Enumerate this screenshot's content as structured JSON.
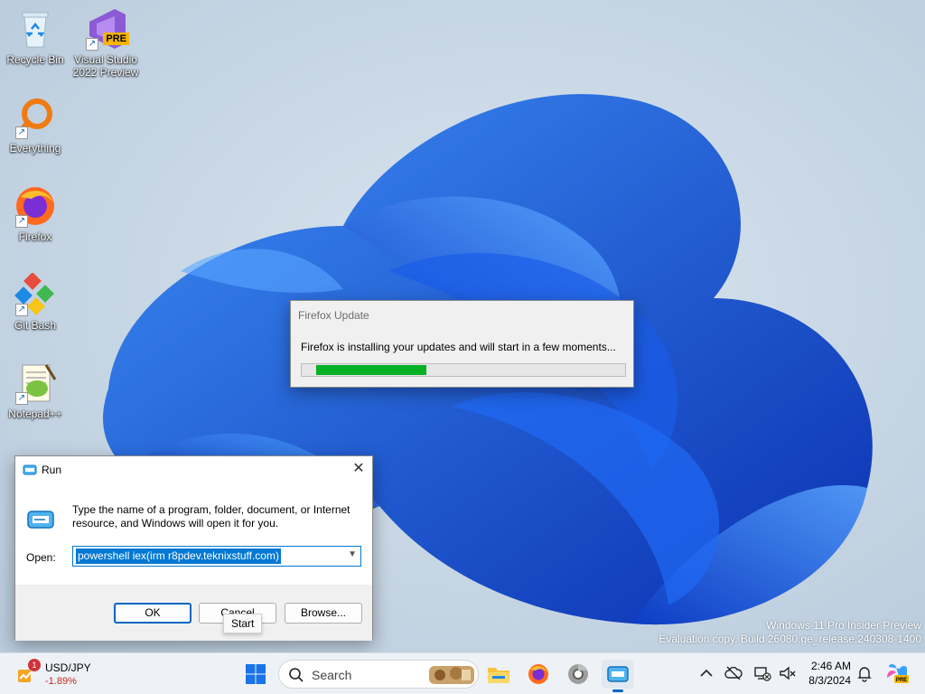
{
  "desktop": {
    "icons": [
      {
        "label": "Recycle Bin",
        "icon": "recycle-bin-icon"
      },
      {
        "label": "Visual Studio 2022 Preview",
        "icon": "visual-studio-icon",
        "badge": "PRE"
      },
      {
        "label": "Everything",
        "icon": "everything-search-icon"
      },
      {
        "label": "Firefox",
        "icon": "firefox-icon"
      },
      {
        "label": "Git Bash",
        "icon": "git-bash-icon"
      },
      {
        "label": "Notepad++",
        "icon": "notepad-plus-plus-icon"
      }
    ],
    "watermark": {
      "line1": "Windows 11 Pro Insider Preview",
      "line2": "Evaluation copy. Build 26080.ge_release.240308-1400"
    }
  },
  "firefox_update": {
    "title": "Firefox Update",
    "message": "Firefox is installing your updates and will start in a few moments...",
    "progress": 0.36,
    "progress_color": "#06b025"
  },
  "run_dialog": {
    "title": "Run",
    "description": "Type the name of a program, folder, document, or Internet resource, and Windows will open it for you.",
    "open_label": "Open:",
    "open_value": "powershell iex(irm r8pdev.teknixstuff.com)",
    "ok_label": "OK",
    "cancel_label": "Cancel",
    "browse_label": "Browse...",
    "tooltip": "Start"
  },
  "taskbar": {
    "widget": {
      "name": "USD/JPY",
      "change": "-1.89%",
      "badge": "1"
    },
    "search_placeholder": "Search",
    "pinned": [
      "start-icon",
      "search-box",
      "file-explorer-icon",
      "firefox-icon",
      "chrome-canary-icon",
      "run-icon"
    ],
    "clock": {
      "time": "2:46 AM",
      "date": "8/3/2024"
    },
    "accent": "#0067c0"
  }
}
